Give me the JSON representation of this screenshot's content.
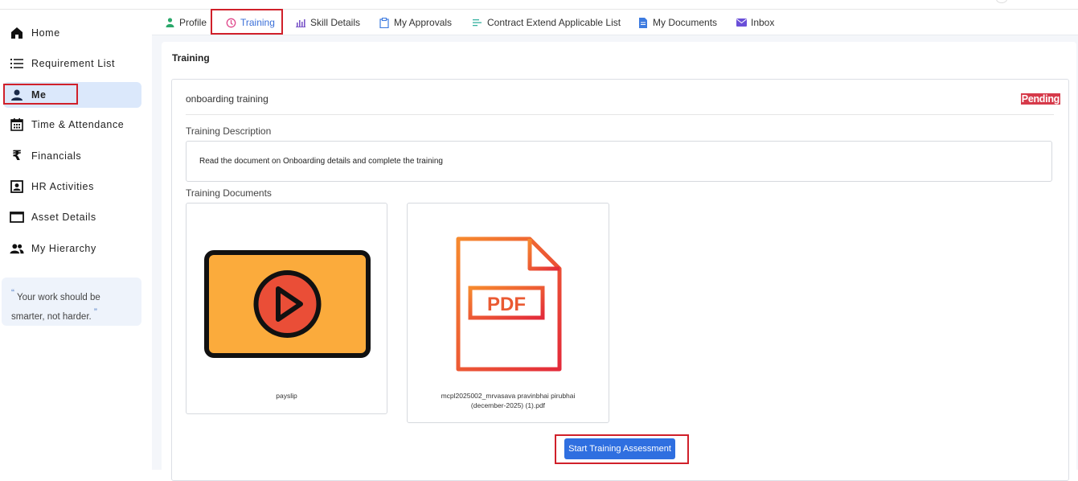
{
  "sidebar": {
    "items": [
      {
        "label": "Home",
        "icon": "home-icon"
      },
      {
        "label": "Requirement List",
        "icon": "list-icon"
      },
      {
        "label": "Me",
        "icon": "user-icon",
        "active": true
      },
      {
        "label": "Time & Attendance",
        "icon": "calendar-icon"
      },
      {
        "label": "Financials",
        "icon": "rupee-icon"
      },
      {
        "label": "HR Activities",
        "icon": "id-badge-icon"
      },
      {
        "label": "Asset Details",
        "icon": "window-icon"
      },
      {
        "label": "My Hierarchy",
        "icon": "people-icon"
      }
    ],
    "quote_open": "“",
    "quote": "Your work should be smarter, not harder.",
    "quote_close": "”"
  },
  "tabs": [
    {
      "label": "Profile",
      "icon": "person-icon"
    },
    {
      "label": "Training",
      "icon": "training-icon",
      "active": true
    },
    {
      "label": "Skill Details",
      "icon": "bar-chart-icon"
    },
    {
      "label": "My Approvals",
      "icon": "clipboard-icon"
    },
    {
      "label": "Contract Extend Applicable List",
      "icon": "lines-icon"
    },
    {
      "label": "My Documents",
      "icon": "document-icon"
    },
    {
      "label": "Inbox",
      "icon": "mail-icon"
    }
  ],
  "training": {
    "section_title": "Training",
    "name": "onboarding training",
    "status": "Pending",
    "description_label": "Training Description",
    "description": "Read the document on Onboarding details and complete the training",
    "documents_label": "Training Documents",
    "documents": [
      {
        "caption": "payslip",
        "type": "video",
        "icon": "video-play-icon"
      },
      {
        "caption_line1": "mcpl2025002_mrvasava pravinbhai pirubhai",
        "caption_line2": "(december-2025) (1).pdf",
        "type": "pdf",
        "icon": "pdf-file-icon",
        "icon_text": "PDF"
      }
    ],
    "action_button": "Start Training Assessment"
  },
  "colors": {
    "accent": "#2f6fe0",
    "status_pending": "#d63a4a",
    "highlight": "#d0202a",
    "active_nav_bg": "#dbe8fb"
  }
}
